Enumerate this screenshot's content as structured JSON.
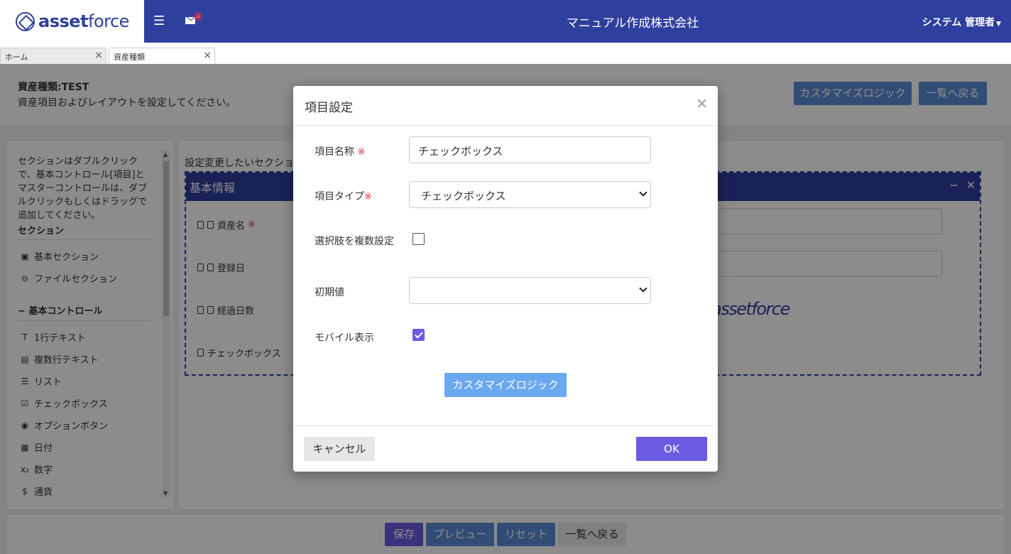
{
  "header": {
    "logo_bold": "asset",
    "logo_light": "force",
    "company": "マニュアル作成株式会社",
    "user": "システム 管理者"
  },
  "tabs": [
    {
      "label": "ホーム"
    },
    {
      "label": "資産種類"
    }
  ],
  "page": {
    "title": "資産種類:TEST",
    "description": "資産項目およびレイアウトを設定してください。",
    "custom_logic_label": "カスタマイズロジック",
    "back_label": "一覧へ戻る"
  },
  "left_panel": {
    "description": "セクションはダブルクリックで、基本コントロール[項目]とマスターコントロールは、ダブルクリックもしくはドラッグで追加してください。",
    "section_heading": "セクション",
    "section_items": [
      "基本セクション",
      "ファイルセクション"
    ],
    "basic_heading": "− 基本コントロール",
    "basic_items": [
      "1行テキスト",
      "複数行テキスト",
      "リスト",
      "チェックボックス",
      "オプションボタン",
      "日付",
      "数字",
      "通貨"
    ]
  },
  "right_panel": {
    "hint": "設定変更したいセクショ",
    "section_title": "基本情報",
    "fields": [
      {
        "label": "資産名",
        "required": "※"
      },
      {
        "label": "登録日",
        "required": ""
      },
      {
        "label": "経過日数",
        "required": ""
      },
      {
        "label": "チェックボックス",
        "required": ""
      }
    ],
    "logo_text": "assetforce"
  },
  "footer": {
    "save": "保存",
    "preview": "プレビュー",
    "reset": "リセット",
    "back": "一覧へ戻る"
  },
  "modal": {
    "title": "項目設定",
    "close": "×",
    "name_label": "項目名称",
    "required_mark": "※",
    "name_value": "チェックボックス",
    "type_label": "項目タイプ",
    "type_value": "チェックボックス",
    "multi_label": "選択肢を複数設定",
    "multi_checked": false,
    "default_label": "初期値",
    "default_value": "",
    "mobile_label": "モバイル表示",
    "mobile_checked": true,
    "custom_logic_label": "カスタマイズロジック",
    "cancel_label": "キャンセル",
    "ok_label": "OK"
  },
  "colors": {
    "header": "#2f3f9e",
    "primary_purple": "#6a5be0",
    "button_blue": "#5b8dd6"
  }
}
